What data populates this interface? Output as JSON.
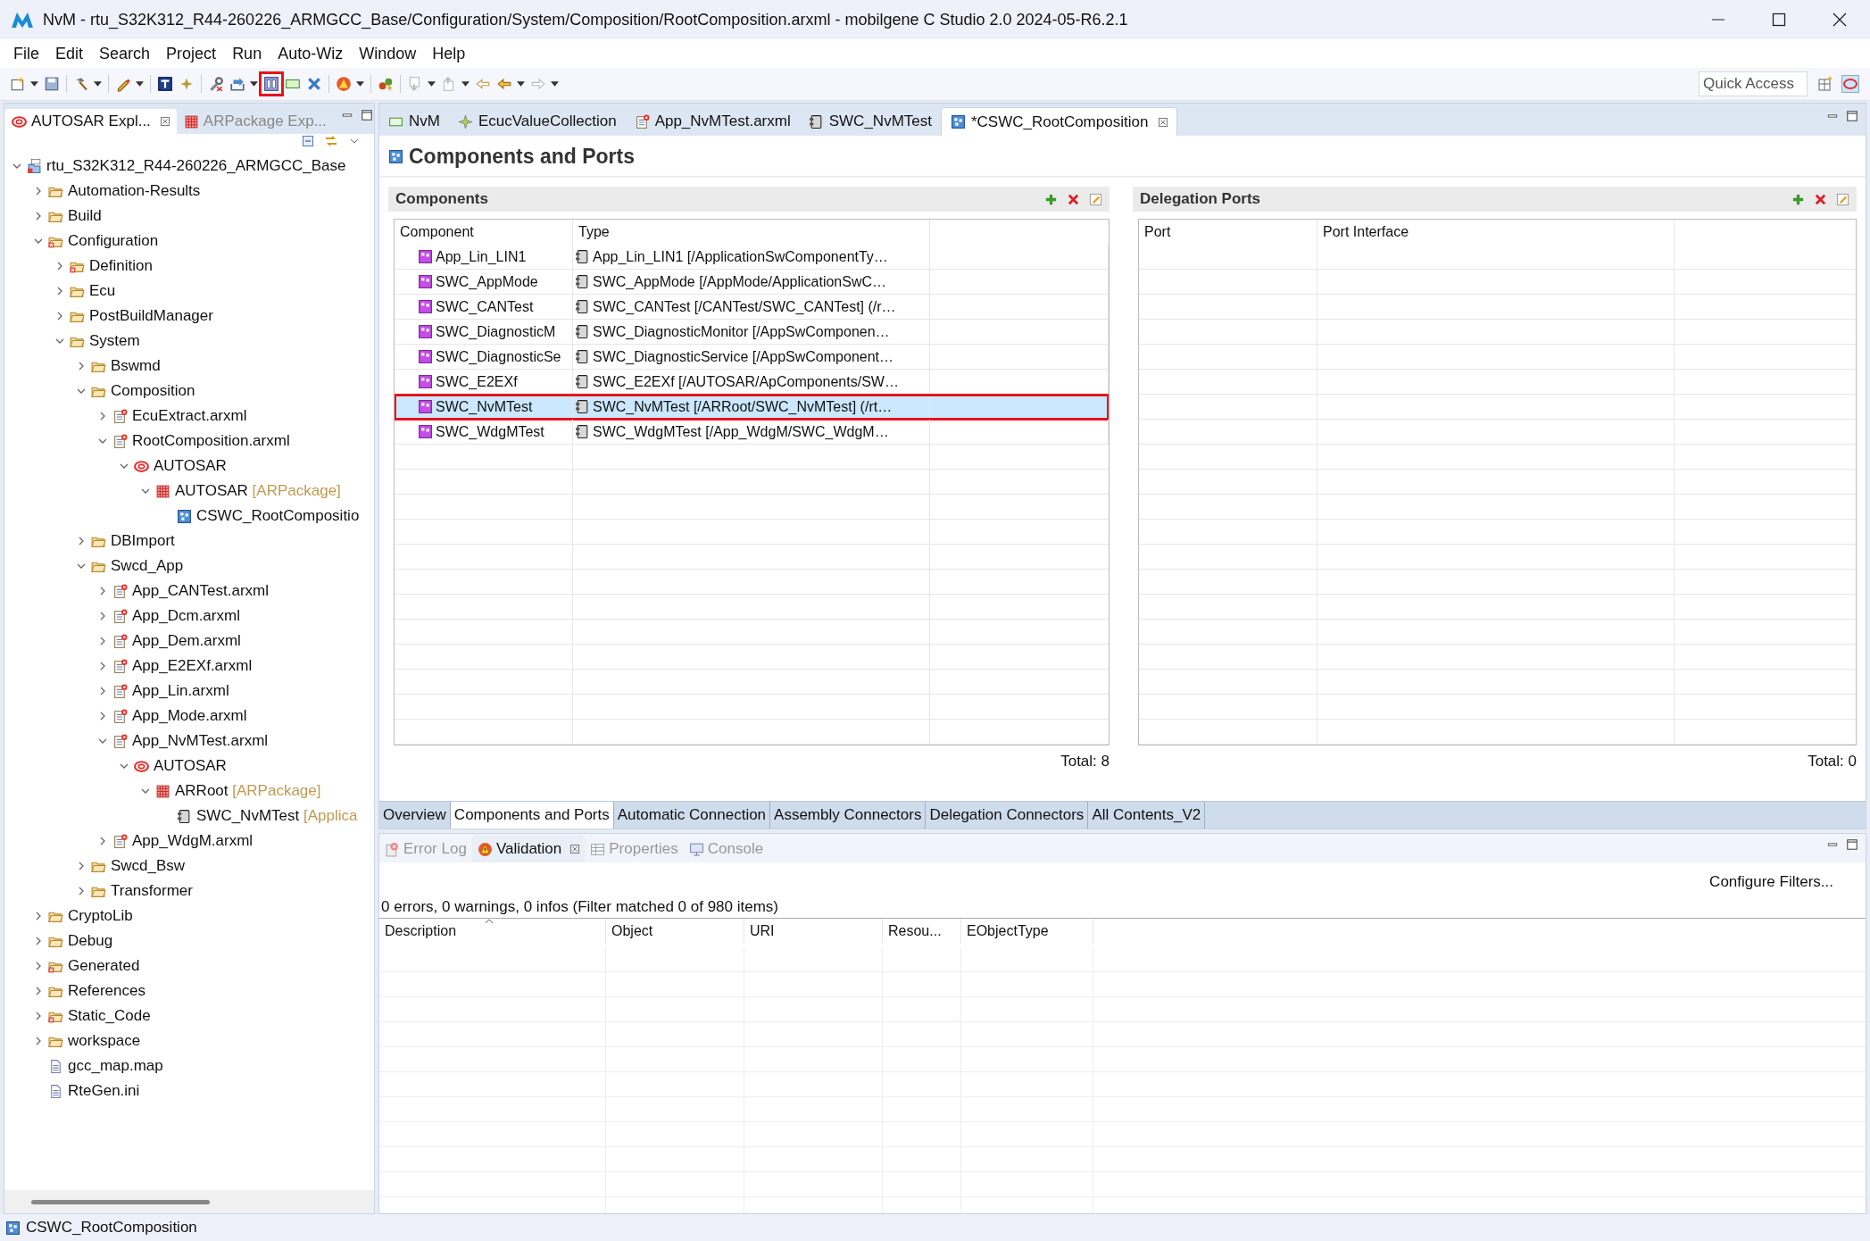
{
  "window": {
    "title": "NvM - rtu_S32K312_R44-260226_ARMGCC_Base/Configuration/System/Composition/RootComposition.arxml - mobilgene C Studio 2.0 2024-05-R6.2.1"
  },
  "menu": [
    "File",
    "Edit",
    "Search",
    "Project",
    "Run",
    "Auto-Wiz",
    "Window",
    "Help"
  ],
  "toolbar": [
    {
      "kind": "new",
      "menu": true,
      "highlighted": false
    },
    {
      "kind": "save",
      "menu": false,
      "highlighted": false
    },
    {
      "kind": "sep"
    },
    {
      "kind": "hammer",
      "menu": true,
      "highlighted": false
    },
    {
      "kind": "sep"
    },
    {
      "kind": "wand",
      "menu": true,
      "highlighted": false
    },
    {
      "kind": "sep"
    },
    {
      "kind": "text",
      "menu": false,
      "highlighted": false
    },
    {
      "kind": "star",
      "menu": false,
      "highlighted": false
    },
    {
      "kind": "sep"
    },
    {
      "kind": "tool",
      "menu": false,
      "highlighted": false
    },
    {
      "kind": "import",
      "menu": true,
      "highlighted": false
    },
    {
      "kind": "component",
      "menu": false,
      "highlighted": true
    },
    {
      "kind": "rect",
      "menu": false,
      "highlighted": false
    },
    {
      "kind": "cross",
      "menu": false,
      "highlighted": false
    },
    {
      "kind": "sep"
    },
    {
      "kind": "warning",
      "menu": true,
      "highlighted": false
    },
    {
      "kind": "sep"
    },
    {
      "kind": "gears",
      "menu": false,
      "highlighted": false
    },
    {
      "kind": "sep"
    },
    {
      "kind": "next",
      "menu": true,
      "highlighted": false
    },
    {
      "kind": "prev",
      "menu": true,
      "highlighted": false
    },
    {
      "kind": "back",
      "menu": false,
      "highlighted": false
    },
    {
      "kind": "left",
      "menu": true,
      "highlighted": false
    },
    {
      "kind": "right",
      "menu": true,
      "highlighted": false
    }
  ],
  "quick_access": {
    "placeholder": "Quick Access"
  },
  "explorer": {
    "tabs": [
      {
        "label": "AUTOSAR Expl...",
        "kind": "autosar",
        "selected": true
      },
      {
        "label": "ARPackage Exp...",
        "kind": "package",
        "selected": false
      }
    ],
    "tree": [
      {
        "label": "rtu_S32K312_R44-260226_ARMGCC_Base",
        "kind": "project",
        "expanded": true,
        "children": [
          {
            "label": "Automation-Results",
            "kind": "folder",
            "expanded": false
          },
          {
            "label": "Build",
            "kind": "folder",
            "expanded": false
          },
          {
            "label": "Configuration",
            "kind": "errfolder",
            "expanded": true,
            "children": [
              {
                "label": "Definition",
                "kind": "errfolder",
                "expanded": false
              },
              {
                "label": "Ecu",
                "kind": "folder",
                "expanded": false
              },
              {
                "label": "PostBuildManager",
                "kind": "folder",
                "expanded": false
              },
              {
                "label": "System",
                "kind": "folder",
                "expanded": true,
                "children": [
                  {
                    "label": "Bswmd",
                    "kind": "folder",
                    "expanded": false
                  },
                  {
                    "label": "Composition",
                    "kind": "folder",
                    "expanded": true,
                    "children": [
                      {
                        "label": "EcuExtract.arxml",
                        "kind": "arxml",
                        "expanded": false
                      },
                      {
                        "label": "RootComposition.arxml",
                        "kind": "arxml",
                        "expanded": true,
                        "children": [
                          {
                            "label": "AUTOSAR",
                            "kind": "autosar",
                            "expanded": true,
                            "children": [
                              {
                                "label": "AUTOSAR",
                                "suffix": "[ARPackage]",
                                "kind": "package",
                                "expanded": true,
                                "children": [
                                  {
                                    "label": "CSWC_RootCompositio",
                                    "kind": "composition"
                                  }
                                ]
                              }
                            ]
                          }
                        ]
                      }
                    ]
                  },
                  {
                    "label": "DBImport",
                    "kind": "folder",
                    "expanded": false
                  },
                  {
                    "label": "Swcd_App",
                    "kind": "folder",
                    "expanded": true,
                    "children": [
                      {
                        "label": "App_CANTest.arxml",
                        "kind": "arxml",
                        "expanded": false
                      },
                      {
                        "label": "App_Dcm.arxml",
                        "kind": "arxml",
                        "expanded": false
                      },
                      {
                        "label": "App_Dem.arxml",
                        "kind": "arxml",
                        "expanded": false
                      },
                      {
                        "label": "App_E2EXf.arxml",
                        "kind": "arxml",
                        "expanded": false
                      },
                      {
                        "label": "App_Lin.arxml",
                        "kind": "arxml",
                        "expanded": false
                      },
                      {
                        "label": "App_Mode.arxml",
                        "kind": "arxml",
                        "expanded": false
                      },
                      {
                        "label": "App_NvMTest.arxml",
                        "kind": "arxml",
                        "expanded": true,
                        "children": [
                          {
                            "label": "AUTOSAR",
                            "kind": "autosar",
                            "expanded": true,
                            "children": [
                              {
                                "label": "ARRoot",
                                "suffix": "[ARPackage]",
                                "kind": "package",
                                "expanded": true,
                                "children": [
                                  {
                                    "label": "SWC_NvMTest",
                                    "suffix": "[Applica",
                                    "kind": "swc"
                                  }
                                ]
                              }
                            ]
                          }
                        ]
                      },
                      {
                        "label": "App_WdgM.arxml",
                        "kind": "arxml",
                        "expanded": false
                      }
                    ]
                  },
                  {
                    "label": "Swcd_Bsw",
                    "kind": "folder",
                    "expanded": false
                  },
                  {
                    "label": "Transformer",
                    "kind": "folder",
                    "expanded": false
                  }
                ]
              }
            ]
          },
          {
            "label": "CryptoLib",
            "kind": "folder",
            "expanded": false
          },
          {
            "label": "Debug",
            "kind": "folder",
            "expanded": false
          },
          {
            "label": "Generated",
            "kind": "errfolder",
            "expanded": false
          },
          {
            "label": "References",
            "kind": "folder",
            "expanded": false
          },
          {
            "label": "Static_Code",
            "kind": "errfolder",
            "expanded": false
          },
          {
            "label": "workspace",
            "kind": "folder",
            "expanded": false
          },
          {
            "label": "gcc_map.map",
            "kind": "file"
          },
          {
            "label": "RteGen.ini",
            "kind": "file"
          }
        ]
      }
    ]
  },
  "editor": {
    "tabs": [
      {
        "label": "NvM",
        "kind": "ecuc",
        "selected": false
      },
      {
        "label": "EcucValueCollection",
        "kind": "star",
        "selected": false
      },
      {
        "label": "App_NvMTest.arxml",
        "kind": "arxml",
        "selected": false
      },
      {
        "label": "SWC_NvMTest",
        "kind": "swc",
        "selected": false
      },
      {
        "label": "*CSWC_RootComposition",
        "kind": "composition",
        "selected": true
      }
    ],
    "title": "Components and Ports",
    "components": {
      "title": "Components",
      "columns": [
        "Component",
        "Type"
      ],
      "rows": [
        {
          "component": "App_Lin_LIN1",
          "type": "App_Lin_LIN1 [/ApplicationSwComponentTy…",
          "selected": false,
          "highlighted": false
        },
        {
          "component": "SWC_AppMode",
          "type": "SWC_AppMode [/AppMode/ApplicationSwC…",
          "selected": false,
          "highlighted": false
        },
        {
          "component": "SWC_CANTest",
          "type": "SWC_CANTest [/CANTest/SWC_CANTest] (/r…",
          "selected": false,
          "highlighted": false
        },
        {
          "component": "SWC_DiagnosticM",
          "type": "SWC_DiagnosticMonitor [/AppSwComponen…",
          "selected": false,
          "highlighted": false
        },
        {
          "component": "SWC_DiagnosticSe",
          "type": "SWC_DiagnosticService [/AppSwComponent…",
          "selected": false,
          "highlighted": false
        },
        {
          "component": "SWC_E2EXf",
          "type": "SWC_E2EXf [/AUTOSAR/ApComponents/SW…",
          "selected": false,
          "highlighted": false
        },
        {
          "component": "SWC_NvMTest",
          "type": "SWC_NvMTest [/ARRoot/SWC_NvMTest] (/rt…",
          "selected": true,
          "highlighted": true
        },
        {
          "component": "SWC_WdgMTest",
          "type": "SWC_WdgMTest [/App_WdgM/SWC_WdgM…",
          "selected": false,
          "highlighted": false
        }
      ],
      "total": "Total: 8"
    },
    "delegation_ports": {
      "title": "Delegation Ports",
      "columns": [
        "Port",
        "Port Interface"
      ],
      "total": "Total: 0"
    },
    "pages": [
      {
        "label": "Overview",
        "selected": false
      },
      {
        "label": "Components and Ports",
        "selected": true
      },
      {
        "label": "Automatic Connection",
        "selected": false
      },
      {
        "label": "Assembly Connectors",
        "selected": false
      },
      {
        "label": "Delegation Connectors",
        "selected": false
      },
      {
        "label": "All Contents_V2",
        "selected": false
      }
    ]
  },
  "bottom": {
    "tabs": [
      {
        "label": "Error Log",
        "kind": "errorlog",
        "selected": false
      },
      {
        "label": "Validation",
        "kind": "warning",
        "selected": true
      },
      {
        "label": "Properties",
        "kind": "properties",
        "selected": false
      },
      {
        "label": "Console",
        "kind": "console",
        "selected": false
      }
    ],
    "configure": "Configure Filters...",
    "summary": "0 errors, 0 warnings, 0 infos (Filter matched 0 of 980 items)",
    "columns": [
      {
        "label": "Description",
        "sorted": true
      },
      {
        "label": "Object",
        "sorted": false
      },
      {
        "label": "URI",
        "sorted": false
      },
      {
        "label": "Resou...",
        "sorted": false
      },
      {
        "label": "EObjectType",
        "sorted": false
      }
    ]
  },
  "status_bar": {
    "text": "CSWC_RootComposition"
  }
}
